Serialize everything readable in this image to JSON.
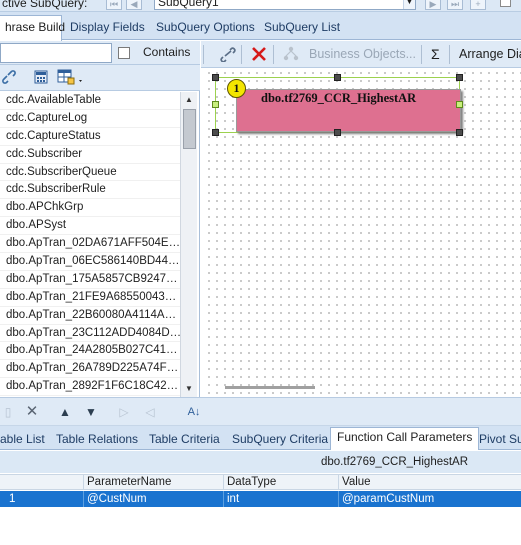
{
  "window": {
    "active_subquery_label": "ctive SubQuery:",
    "subquery_combo_value": "SubQuery1"
  },
  "main_tabs": [
    {
      "label": "hrase Build",
      "active": true
    },
    {
      "label": "Display Fields",
      "active": false
    },
    {
      "label": "SubQuery Options",
      "active": false
    },
    {
      "label": "SubQuery List",
      "active": false
    }
  ],
  "filter": {
    "input_value": "",
    "contains_label": "Contains",
    "contains_checked": false
  },
  "table_list": [
    "cdc.AvailableTable",
    "cdc.CaptureLog",
    "cdc.CaptureStatus",
    "cdc.Subscriber",
    "cdc.SubscriberQueue",
    "cdc.SubscriberRule",
    "dbo.APChkGrp",
    "dbo.APSyst",
    "dbo.ApTran_02DA671AFF504E…",
    "dbo.ApTran_06EC586140BD44…",
    "dbo.ApTran_175A5857CB9247…",
    "dbo.ApTran_21FE9A68550043…",
    "dbo.ApTran_22B60080A4114A…",
    "dbo.ApTran_23C112ADD4084D…",
    "dbo.ApTran_24A2805B027C41…",
    "dbo.ApTran_26A789D225A74F…",
    "dbo.ApTran_2892F1F6C18C42…"
  ],
  "canvas_toolbar": {
    "business_objects_label": "Business Objects...",
    "sigma_label": "Σ",
    "arrange_label": "Arrange Dia"
  },
  "canvas": {
    "table_name": "dbo.tf2769_CCR_HighestAR",
    "order_badge": "1"
  },
  "bottom_tabs": [
    {
      "label": "able List",
      "active": false
    },
    {
      "label": "Table Relations",
      "active": false
    },
    {
      "label": "Table Criteria",
      "active": false
    },
    {
      "label": "SubQuery Criteria",
      "active": false
    },
    {
      "label": "Function Call Parameters",
      "active": true
    },
    {
      "label": "Pivot Su",
      "active": false
    }
  ],
  "grid": {
    "caption": "dbo.tf2769_CCR_HighestAR",
    "headers": [
      "ParameterName",
      "DataType",
      "Value"
    ],
    "rows": [
      {
        "num": "1",
        "name": "@CustNum",
        "type": "int",
        "value": "@paramCustNum"
      }
    ]
  },
  "icons": {
    "link": "link-icon",
    "delete": "delete-icon",
    "business_objects": "business-objects-icon",
    "calculator": "calculator-icon",
    "table_add": "table-add-icon"
  },
  "colors": {
    "table_box_fill": "#de7090",
    "selection_accent": "#9cd14e",
    "badge_fill": "#f3e500",
    "selected_row": "#1a73cf"
  }
}
